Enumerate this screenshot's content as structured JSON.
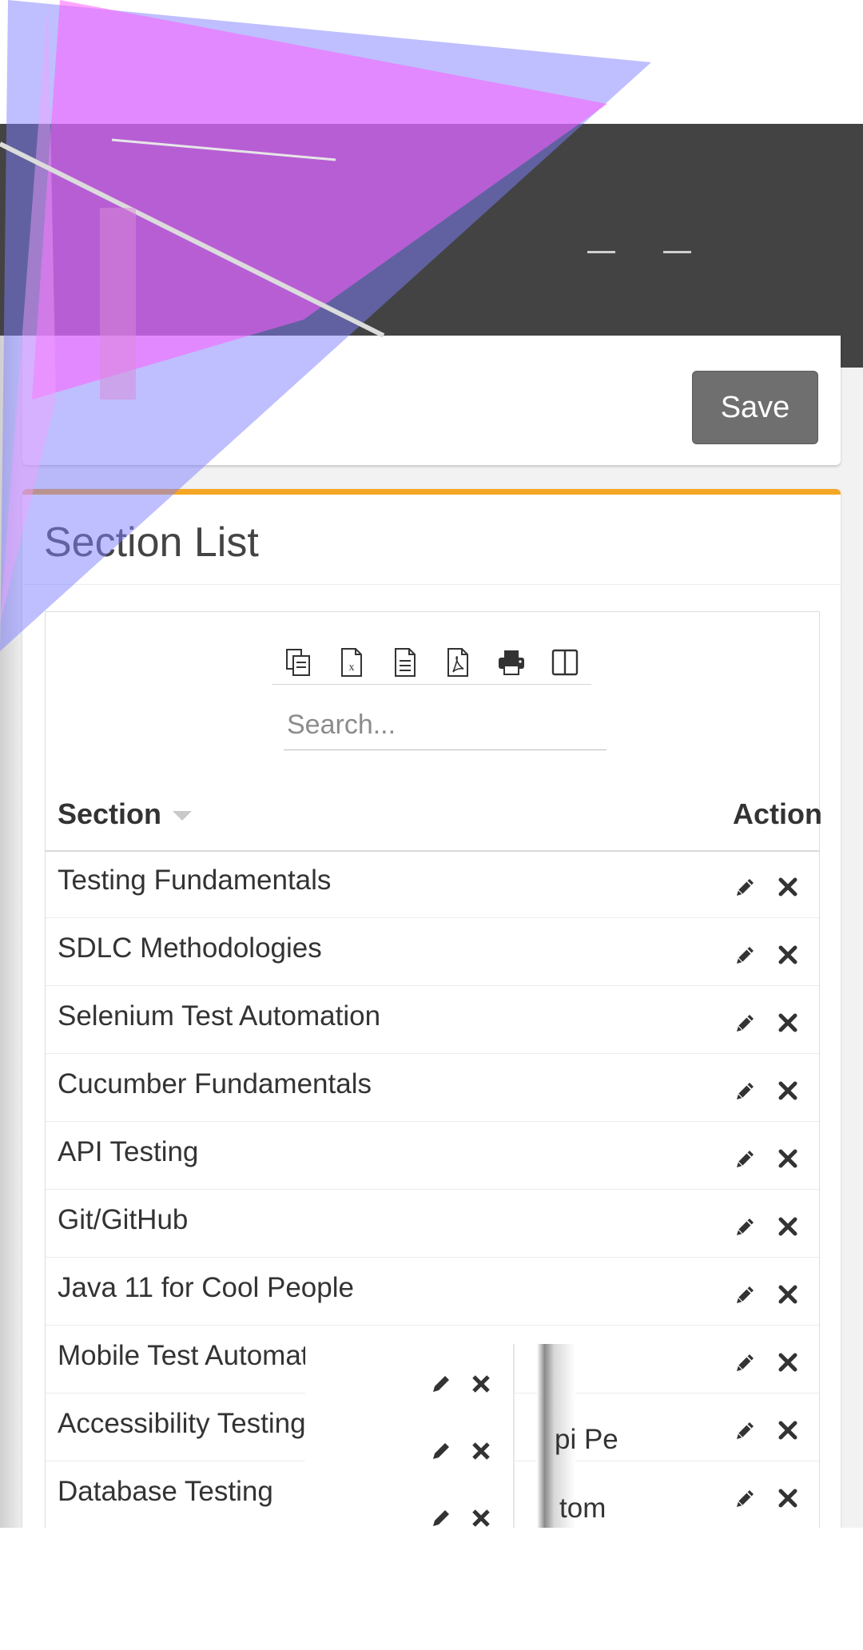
{
  "form": {
    "save_label": "Save"
  },
  "section_list": {
    "title": "Section List",
    "search_placeholder": "Search...",
    "columns": {
      "section": "Section",
      "action": "Action"
    },
    "export_tools": [
      {
        "name": "copy-icon"
      },
      {
        "name": "excel-icon"
      },
      {
        "name": "csv-icon"
      },
      {
        "name": "pdf-icon"
      },
      {
        "name": "print-icon"
      },
      {
        "name": "column-visibility-icon"
      }
    ],
    "rows": [
      {
        "label": "Testing Fundamentals"
      },
      {
        "label": "SDLC Methodologies"
      },
      {
        "label": "Selenium Test Automation"
      },
      {
        "label": "Cucumber Fundamentals"
      },
      {
        "label": "API Testing"
      },
      {
        "label": "Git/GitHub"
      },
      {
        "label": "Java 11 for Cool People"
      },
      {
        "label": "Mobile Test Automation"
      },
      {
        "label": "Accessibility Testing"
      },
      {
        "label": "Database Testing"
      }
    ],
    "ghost_fragments": [
      "pi Pe",
      "tom"
    ]
  },
  "colors": {
    "accent": "#f5a623",
    "header_dark": "#434343",
    "button": "#6f6f6f",
    "glitch_magenta": "#ff33ff",
    "glitch_blue": "#6666ff"
  }
}
